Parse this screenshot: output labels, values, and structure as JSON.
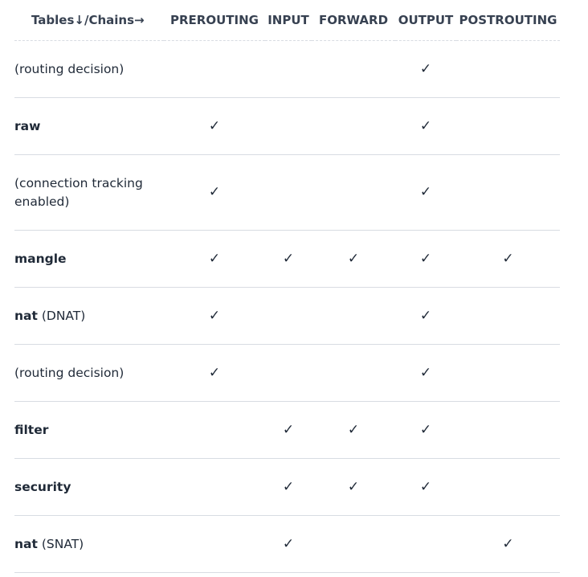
{
  "header": {
    "tables_label": "Tables↓/Chains→",
    "chains": [
      "PREROUTING",
      "INPUT",
      "FORWARD",
      "OUTPUT",
      "POSTROUTING"
    ]
  },
  "check_glyph": "✓",
  "rows": [
    {
      "bold": "",
      "note": "(routing decision)",
      "checks": [
        false,
        false,
        false,
        true,
        false
      ]
    },
    {
      "bold": "raw",
      "note": "",
      "checks": [
        true,
        false,
        false,
        true,
        false
      ]
    },
    {
      "bold": "",
      "note": "(connection tracking enabled)",
      "checks": [
        true,
        false,
        false,
        true,
        false
      ]
    },
    {
      "bold": "mangle",
      "note": "",
      "checks": [
        true,
        true,
        true,
        true,
        true
      ]
    },
    {
      "bold": "nat",
      "note": " (DNAT)",
      "checks": [
        true,
        false,
        false,
        true,
        false
      ]
    },
    {
      "bold": "",
      "note": "(routing decision)",
      "checks": [
        true,
        false,
        false,
        true,
        false
      ]
    },
    {
      "bold": "filter",
      "note": "",
      "checks": [
        false,
        true,
        true,
        true,
        false
      ]
    },
    {
      "bold": "security",
      "note": "",
      "checks": [
        false,
        true,
        true,
        true,
        false
      ]
    },
    {
      "bold": "nat",
      "note": " (SNAT)",
      "checks": [
        false,
        true,
        false,
        false,
        true
      ]
    }
  ]
}
